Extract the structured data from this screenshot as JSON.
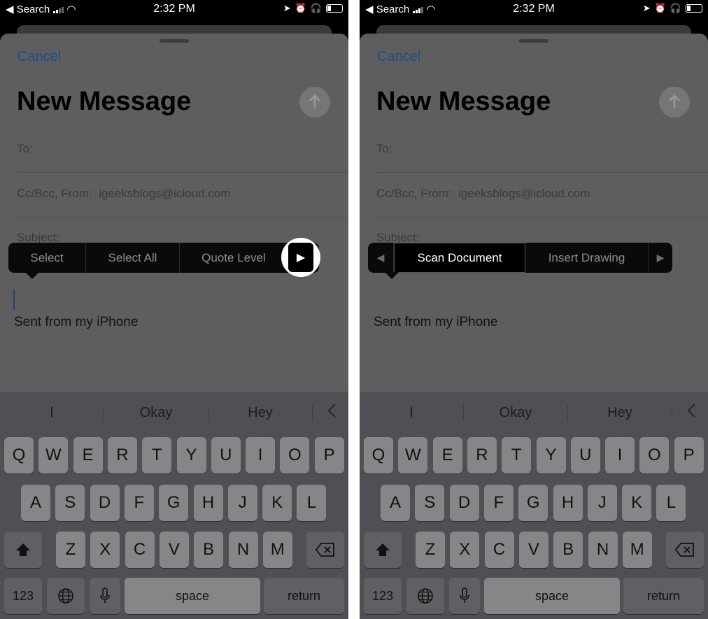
{
  "status_bar": {
    "back_app": "◀ Search",
    "time": "2:32 PM",
    "icons": [
      "signal-icon",
      "wifi-icon",
      "location-icon",
      "alarm-icon",
      "headphones-icon",
      "battery-icon"
    ]
  },
  "compose": {
    "cancel": "Cancel",
    "title": "New Message",
    "to_label": "To:",
    "cc_label": "Cc/Bcc, From:",
    "from_address": "igeeksblogs@icloud.com",
    "subject_label": "Subject:",
    "signature": "Sent from my iPhone"
  },
  "menu_left": {
    "items": [
      "Select",
      "Select All",
      "Quote Level"
    ],
    "next_arrow": "▶"
  },
  "menu_right": {
    "prev_arrow": "◀",
    "items": [
      "Scan Document",
      "Insert Drawing"
    ],
    "next_arrow": "▶",
    "selected": "Scan Document"
  },
  "keyboard": {
    "predictions": [
      "I",
      "Okay",
      "Hey",
      "<"
    ],
    "row1": [
      "Q",
      "W",
      "E",
      "R",
      "T",
      "Y",
      "U",
      "I",
      "O",
      "P"
    ],
    "row2": [
      "A",
      "S",
      "D",
      "F",
      "G",
      "H",
      "J",
      "K",
      "L"
    ],
    "row3": [
      "Z",
      "X",
      "C",
      "V",
      "B",
      "N",
      "M"
    ],
    "numbers_key": "123",
    "space_key": "space",
    "return_key": "return"
  }
}
